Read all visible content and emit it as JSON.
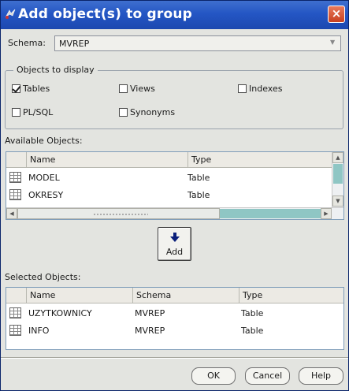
{
  "window": {
    "title": "Add object(s) to group",
    "close_label": "×"
  },
  "schema": {
    "label": "Schema:",
    "value": "MVREP"
  },
  "objects_to_display": {
    "legend": "Objects to display",
    "options": [
      {
        "label": "Tables",
        "checked": true
      },
      {
        "label": "Views",
        "checked": false
      },
      {
        "label": "Indexes",
        "checked": false
      },
      {
        "label": "PL/SQL",
        "checked": false
      },
      {
        "label": "Synonyms",
        "checked": false
      }
    ]
  },
  "available": {
    "label": "Available Objects:",
    "columns": [
      "Name",
      "Type"
    ],
    "rows": [
      {
        "name": "MODEL",
        "type": "Table"
      },
      {
        "name": "OKRESY",
        "type": "Table"
      }
    ]
  },
  "add_button": {
    "label": "Add",
    "icon": "arrow-down-icon"
  },
  "selected": {
    "label": "Selected Objects:",
    "columns": [
      "Name",
      "Schema",
      "Type"
    ],
    "rows": [
      {
        "name": "UZYTKOWNICY",
        "schema": "MVREP",
        "type": "Table"
      },
      {
        "name": "INFO",
        "schema": "MVREP",
        "type": "Table"
      }
    ]
  },
  "buttons": {
    "ok": "OK",
    "cancel": "Cancel",
    "help": "Help"
  }
}
